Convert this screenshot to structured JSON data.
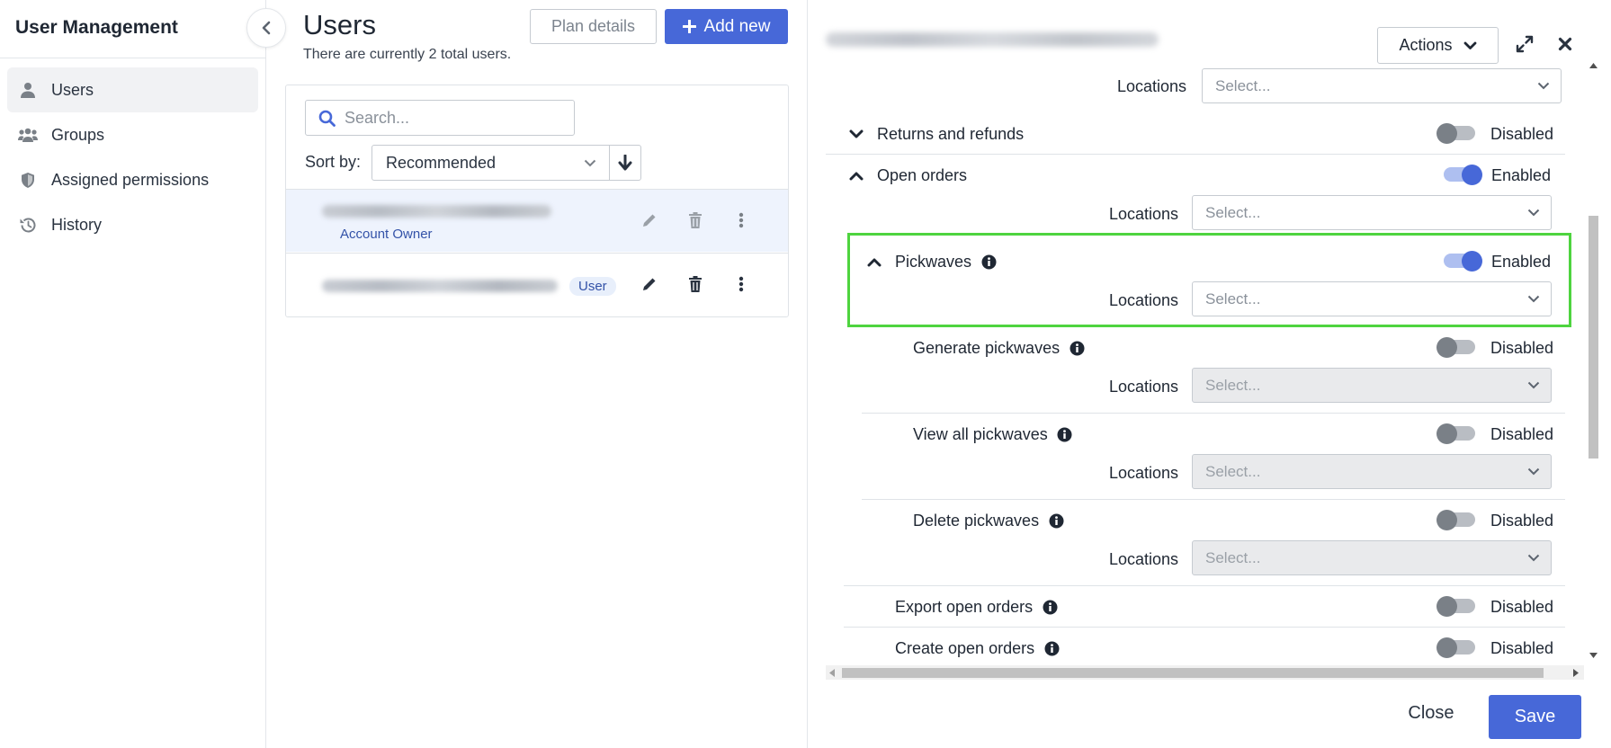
{
  "sidebar": {
    "title": "User Management",
    "items": [
      {
        "label": "Users",
        "icon": "user-icon",
        "active": true
      },
      {
        "label": "Groups",
        "icon": "users-group-icon"
      },
      {
        "label": "Assigned permissions",
        "icon": "shield-icon"
      },
      {
        "label": "History",
        "icon": "history-icon"
      }
    ]
  },
  "users_panel": {
    "title": "Users",
    "count_text": "There are currently 2 total users.",
    "plan_details_label": "Plan details",
    "add_new_label": "Add new",
    "search_placeholder": "Search...",
    "sort_label": "Sort by:",
    "sort_value": "Recommended",
    "users": [
      {
        "email": "(blurred)",
        "role": "Account Owner"
      },
      {
        "email": "(blurred)",
        "role": "User"
      }
    ]
  },
  "detail": {
    "email": "(blurred)",
    "actions_label": "Actions",
    "locations_label": "Locations",
    "select_placeholder": "Select...",
    "enabled_label": "Enabled",
    "disabled_label": "Disabled",
    "permissions": {
      "returns": {
        "label": "Returns and refunds",
        "state": "Disabled"
      },
      "open_orders": {
        "label": "Open orders",
        "state": "Enabled"
      },
      "pickwaves": {
        "label": "Pickwaves",
        "state": "Enabled"
      },
      "generate_pickwaves": {
        "label": "Generate pickwaves",
        "state": "Disabled"
      },
      "view_all_pickwaves": {
        "label": "View all pickwaves",
        "state": "Disabled"
      },
      "delete_pickwaves": {
        "label": "Delete pickwaves",
        "state": "Disabled"
      },
      "export_open_orders": {
        "label": "Export open orders",
        "state": "Disabled"
      },
      "create_open_orders": {
        "label": "Create open orders",
        "state": "Disabled"
      }
    },
    "close_label": "Close",
    "save_label": "Save"
  },
  "colors": {
    "accent": "#4768d8",
    "highlight": "#4ed43f",
    "active_row": "#eef3fd"
  }
}
